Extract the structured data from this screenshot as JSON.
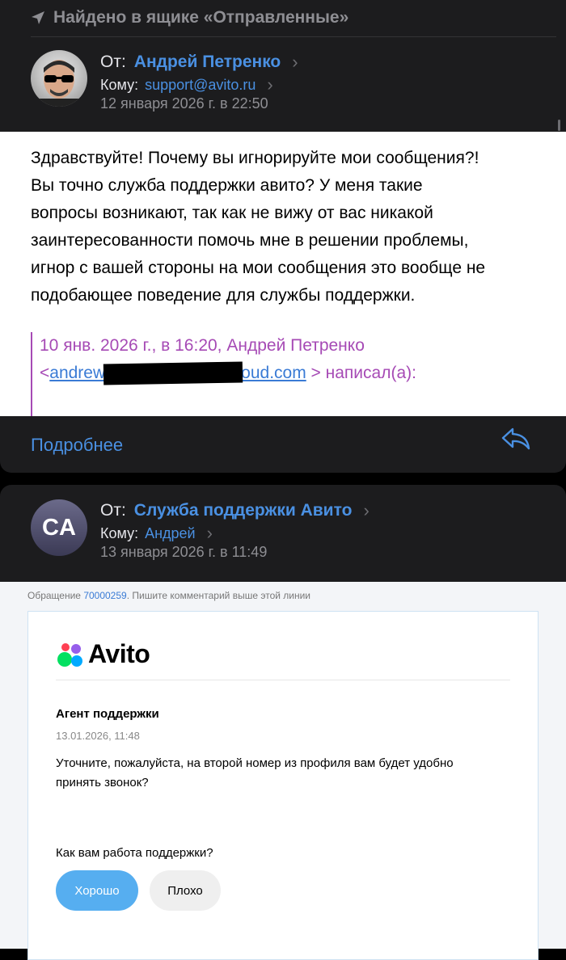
{
  "banner": {
    "text": "Найдено в ящике «Отправленные»"
  },
  "message1": {
    "from_label": "От:",
    "from_name": "Андрей Петренко",
    "to_label": "Кому:",
    "to_value": "support@avito.ru",
    "date": "12 января 2026 г. в 22:50",
    "body": "Здравствуйте! Почему вы игнорируйте мои сообщения?!\nВы точно служба поддержки авито? У меня такие\nвопросы возникают, так как не вижу от вас никакой\nзаинтересованности помочь мне в решении проблемы,\nигнор с вашей стороны на мои сообщения это вообще не\nподобающее поведение для службы поддержки.",
    "quote_line1": "10 янв. 2026 г., в 16:20, Андрей Петренко",
    "quote_lt": "<",
    "quote_email_start": "andrew",
    "quote_email_end": "oud.com",
    "quote_wrote": "> написал(а):",
    "more_label": "Подробнее"
  },
  "message2": {
    "avatar_initials": "CA",
    "from_label": "От:",
    "from_name": "Служба поддержки Авито",
    "to_label": "Кому:",
    "to_value": "Андрей",
    "date": "13 января 2026 г. в 11:49"
  },
  "avito_mail": {
    "ticket_prefix": "Обращение ",
    "ticket_number": "70000259",
    "ticket_suffix": ". Пишите комментарий выше этой линии",
    "logo_text": "Avito",
    "agent_title": "Агент поддержки",
    "timestamp": "13.01.2026, 11:48",
    "message": "Уточните, пожалуйста, на второй номер из профиля вам будет удобно принять звонок?",
    "rating_question": "Как вам работа поддержки?",
    "btn_good": "Хорошо",
    "btn_bad": "Плохо",
    "accent_color": "#56aef0"
  }
}
